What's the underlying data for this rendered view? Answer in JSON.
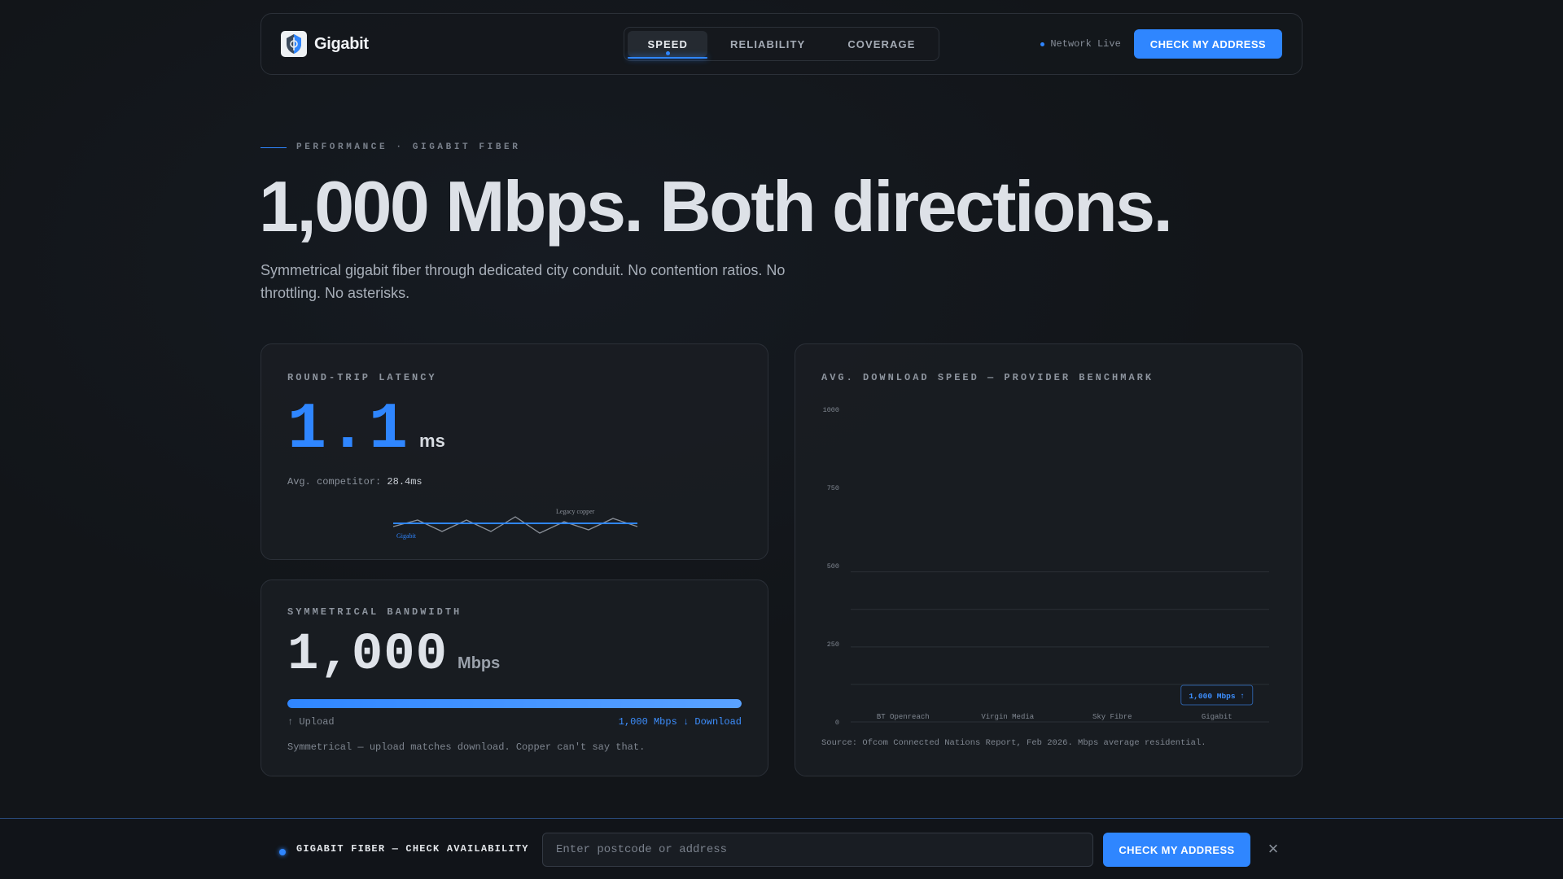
{
  "nav": {
    "brand": "Gigabit",
    "tabs": [
      {
        "label": "SPEED",
        "active": true
      },
      {
        "label": "RELIABILITY",
        "active": false
      },
      {
        "label": "COVERAGE",
        "active": false
      }
    ],
    "status": "Network Live",
    "cta": "CHECK MY ADDRESS"
  },
  "hero": {
    "eyebrow": "PERFORMANCE · GIGABIT FIBER",
    "title": "1,000 Mbps. Both directions.",
    "subtitle": "Symmetrical gigabit fiber through dedicated city conduit. No contention ratios. No throttling. No asterisks."
  },
  "latency": {
    "label": "ROUND-TRIP LATENCY",
    "value": "1.1",
    "unit": "ms",
    "competitor_label": "Avg. competitor:",
    "competitor_value": "28.4ms",
    "legend_legacy": "Legacy copper",
    "legend_gigabit": "Gigabit"
  },
  "bandwidth": {
    "label": "SYMMETRICAL BANDWIDTH",
    "value": "1,000",
    "unit": "Mbps",
    "fill_fraction": 1.0,
    "upload_label": "↑ Upload",
    "download_label": "1,000 Mbps ↓ Download",
    "note": "Symmetrical — upload matches download. Copper can't say that."
  },
  "benchmark": {
    "label": "AVG. DOWNLOAD SPEED — PROVIDER BENCHMARK",
    "source": "Source: Ofcom Connected Nations Report, Feb 2026. Mbps average residential.",
    "tooltip": "1,000 Mbps ↑"
  },
  "chart_data": {
    "type": "bar",
    "categories": [
      "BT Openreach",
      "Virgin Media",
      "Sky Fibre",
      "Gigabit"
    ],
    "values": [
      0,
      0,
      0,
      0
    ],
    "ylim": [
      0,
      1000
    ],
    "yticks": [
      "0",
      "250",
      "500",
      "750",
      "1000"
    ],
    "grid": true,
    "title": "",
    "xlabel": "",
    "ylabel": ""
  },
  "bottom_bar": {
    "label": "GIGABIT FIBER — CHECK AVAILABILITY",
    "input_placeholder": "Enter postcode or address",
    "input_value": "",
    "cta": "CHECK MY ADDRESS"
  },
  "colors": {
    "accent": "#2f86ff",
    "background": "#121519",
    "card": "#1a1d22"
  }
}
